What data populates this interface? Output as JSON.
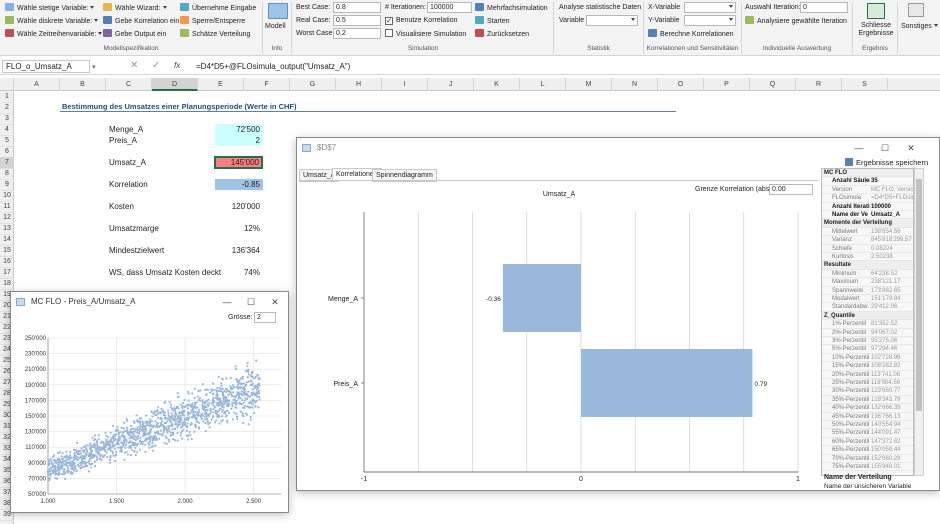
{
  "ribbon": {
    "groups": {
      "model": "Modellspezifikation",
      "info": "Info",
      "simulation": "Simulation",
      "statistics": "Statistik",
      "correlations": "Korrelationen und Sensitivitäten",
      "individual": "Individuelle Auswertung",
      "result": "Ergebnis"
    },
    "model_items": [
      "Wähle stetige Variable:",
      "Wähle diskrete Variable:",
      "Wähle Zeitreihenvariable:",
      "Wähle Wizard:",
      "Gebe Korrelation ein",
      "Gebe Output ein",
      "Übernehme Eingabe",
      "Sperre/Entsperre",
      "Schätze Verteilung"
    ],
    "info_label": "Modell",
    "best_case_label": "Best Case:",
    "best_case_value": "0.8",
    "real_case_label": "Real Case:",
    "real_case_value": "0.5",
    "worst_case_label": "Worst Case:",
    "worst_case_value": "0.2",
    "iterations_label": "# Iterationen:",
    "iterations_value": "100000",
    "use_correlation": "Benutze Korrelation",
    "visualize_simulation": "Visualisiere Simulation",
    "multi_simulation": "Mehrfachsimulation",
    "start": "Starten",
    "reset": "Zurücksetzen",
    "analyse_stats": "Analyse statistische Daten",
    "variable_label": "Variable",
    "x_variable": "X-Variable",
    "y_variable": "Y-Variable",
    "calc_correlations": "Berechne Korrelationen",
    "select_iteration_label": "Auswahl Iteration:",
    "select_iteration_value": "0",
    "analyse_iteration": "Analysiere gewählte Iteration",
    "close_results": "Schliesse Ergebnisse",
    "other": "Sonstiges"
  },
  "formula_bar": {
    "name_box": "FLO_o_Umsatz_A",
    "fx": "fx",
    "formula": "=D4*D5+@FLOsimula_output(\"Umsatz_A\")"
  },
  "columns": [
    "A",
    "B",
    "C",
    "D",
    "E",
    "F",
    "G",
    "H",
    "I",
    "J",
    "K",
    "L",
    "M",
    "N",
    "O",
    "P",
    "Q",
    "R",
    "S"
  ],
  "rows": [
    "1",
    "2",
    "3",
    "4",
    "5",
    "6",
    "7",
    "8",
    "9",
    "10",
    "11",
    "12",
    "13",
    "14",
    "15",
    "16",
    "17",
    "18",
    "19",
    "20",
    "21",
    "22",
    "23",
    "24",
    "25",
    "26",
    "27",
    "28",
    "29",
    "30",
    "31",
    "32",
    "33",
    "34",
    "35",
    "36",
    "37",
    "38",
    "39"
  ],
  "sheet": {
    "title": "Bestimmung des Umsatzes einer Planungsperiode (Werte in CHF)",
    "menge_label": "Menge_A",
    "menge_value": "72'500",
    "preis_label": "Preis_A",
    "preis_value": "2",
    "umsatz_label": "Umsatz_A",
    "umsatz_value": "145'000",
    "korrelation_label": "Korrelation",
    "korrelation_value": "-0.85",
    "kosten_label": "Kosten",
    "kosten_value": "120'000",
    "marge_label": "Umsatzmarge",
    "marge_value": "12%",
    "mindest_label": "Mindestzielwert",
    "mindest_value": "136'364",
    "ws_label": "WS, dass Umsatz Kosten deckt",
    "ws_value": "74%"
  },
  "colors": {
    "input_cyan": "#ccffff",
    "output_red": "#ff7c80",
    "correlation_blue": "#9dc3e6",
    "bar_blue": "#9ab7dc",
    "excel_green": "#217346"
  },
  "corr_window": {
    "title": "$D$7",
    "save_results": "Ergebnisse speichern",
    "tabs": [
      "Umsatz_A",
      "Korrelationen",
      "Spinnendiagramm"
    ],
    "threshold_label": "Grenze Korrelation (abs.):",
    "threshold_value": "0.00"
  },
  "scatter_window": {
    "title": "MC FLO - Preis_A/Umsatz_A",
    "size_label": "Grösse:",
    "size_value": "2"
  },
  "side_panel": {
    "sections": [
      {
        "title": "MC FLO",
        "rows": [
          [
            "Anzahl Säulen",
            "35",
            true
          ],
          [
            "Version",
            "MC FLO, Version",
            false
          ],
          [
            "FLOsimula",
            "=D4*D5+FLOsim",
            false
          ],
          [
            "Anzahl Iterati",
            "100000",
            true
          ],
          [
            "Name der Ve",
            "Umsatz_A",
            true
          ]
        ]
      },
      {
        "title": "Momente der Verteilung",
        "rows": [
          [
            "Mittelwert",
            "138'654.56",
            false
          ],
          [
            "Varianz",
            "845'818'299.57",
            false
          ],
          [
            "Schiefe",
            "0.08224",
            false
          ],
          [
            "Kurtosis",
            "2.50238",
            false
          ]
        ]
      },
      {
        "title": "Resultate",
        "rows": [
          [
            "Minimum",
            "64'238.52",
            false
          ],
          [
            "Maximum",
            "238'121.17",
            false
          ],
          [
            "Spannweite",
            "173'882.65",
            false
          ],
          [
            "Modalwert",
            "151'179.84",
            false
          ],
          [
            "Standardabw.",
            "29'412.96",
            false
          ]
        ]
      },
      {
        "title": "Z_Quantile",
        "rows": [
          [
            "1%-Perzentil",
            "81'352.52",
            false
          ],
          [
            "2%-Perzentil",
            "94'067.02",
            false
          ],
          [
            "3%-Perzentil",
            "95'275.06",
            false
          ],
          [
            "5%-Perzentil",
            "97'294.46",
            false
          ],
          [
            "10%-Perzentil",
            "102'728.96",
            false
          ],
          [
            "15%-Perzentil",
            "108'282.82",
            false
          ],
          [
            "20%-Perzentil",
            "113'741.08",
            false
          ],
          [
            "25%-Perzentil",
            "118'904.56",
            false
          ],
          [
            "30%-Perzentil",
            "123'660.77",
            false
          ],
          [
            "35%-Perzentil",
            "128'343.79",
            false
          ],
          [
            "40%-Perzentil",
            "132'666.39",
            false
          ],
          [
            "45%-Perzentil",
            "136'766.13",
            false
          ],
          [
            "50%-Perzentil",
            "140'554.94",
            false
          ],
          [
            "55%-Perzentil",
            "144'091.47",
            false
          ],
          [
            "60%-Perzentil",
            "147'372.62",
            false
          ],
          [
            "65%-Perzentil",
            "150'059.44",
            false
          ],
          [
            "70%-Perzentil",
            "152'660.28",
            false
          ],
          [
            "75%-Perzentil",
            "155'948.01",
            false
          ]
        ]
      }
    ],
    "footer_title": "Name der Verteilung",
    "footer_text": "Name der unsicheren Variable"
  },
  "chart_data": [
    {
      "type": "bar",
      "orientation": "horizontal",
      "title": "Umsatz_A",
      "categories": [
        "Menge_A",
        "Preis_A"
      ],
      "values": [
        -0.36,
        0.79
      ],
      "xlim": [
        -1,
        1
      ],
      "xticks": [
        "-1",
        "0",
        "1"
      ],
      "grid": true
    },
    {
      "type": "scatter",
      "title": "",
      "xlabel": "",
      "ylabel": "",
      "xlim": [
        1.0,
        2.7
      ],
      "ylim": [
        50000,
        250000
      ],
      "xticks": [
        "1.000",
        "1.500",
        "2.000",
        "2.500"
      ],
      "yticks": [
        "50'000",
        "70'000",
        "90'000",
        "110'000",
        "130'000",
        "150'000",
        "170'000",
        "190'000",
        "210'000",
        "230'000",
        "250'000"
      ],
      "point_cloud": {
        "x_min": 1.0,
        "x_max": 2.55,
        "y_low_at_x_min": 60000,
        "y_high_at_x_min": 100000,
        "y_low_at_x_max": 140000,
        "y_high_at_x_max": 235000
      },
      "grid": true
    }
  ]
}
